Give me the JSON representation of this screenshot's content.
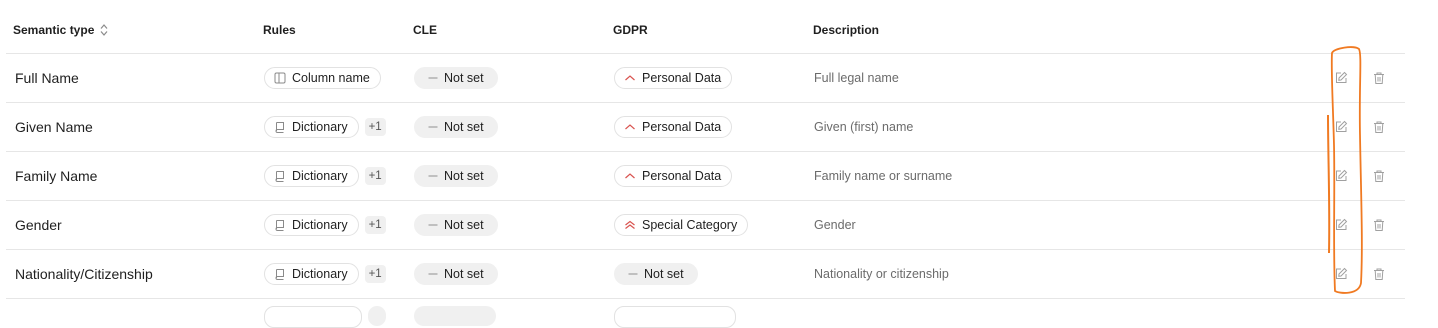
{
  "columns": {
    "semantic_type": "Semantic type",
    "rules": "Rules",
    "cle": "CLE",
    "gdpr": "GDPR",
    "description": "Description"
  },
  "rows": [
    {
      "name": "Full Name",
      "rule": "Column name",
      "rule_icon": "column-icon",
      "extra": "",
      "cle": "Not set",
      "gdpr": "Personal Data",
      "gdpr_icon": "chevron-up-icon",
      "description": "Full legal name"
    },
    {
      "name": "Given Name",
      "rule": "Dictionary",
      "rule_icon": "dictionary-icon",
      "extra": "+1",
      "cle": "Not set",
      "gdpr": "Personal Data",
      "gdpr_icon": "chevron-up-icon",
      "description": "Given (first) name"
    },
    {
      "name": "Family Name",
      "rule": "Dictionary",
      "rule_icon": "dictionary-icon",
      "extra": "+1",
      "cle": "Not set",
      "gdpr": "Personal Data",
      "gdpr_icon": "chevron-up-icon",
      "description": "Family name or surname"
    },
    {
      "name": "Gender",
      "rule": "Dictionary",
      "rule_icon": "dictionary-icon",
      "extra": "+1",
      "cle": "Not set",
      "gdpr": "Special Category",
      "gdpr_icon": "double-chevron-up-icon",
      "description": "Gender"
    },
    {
      "name": "Nationality/Citizenship",
      "rule": "Dictionary",
      "rule_icon": "dictionary-icon",
      "extra": "+1",
      "cle": "Not set",
      "gdpr": "Not set",
      "gdpr_icon": "dash-icon",
      "description": "Nationality or citizenship"
    }
  ],
  "colors": {
    "accent_red": "#d9534f",
    "annotation_orange": "#f07a22",
    "muted_icon": "#a0a0a0"
  }
}
